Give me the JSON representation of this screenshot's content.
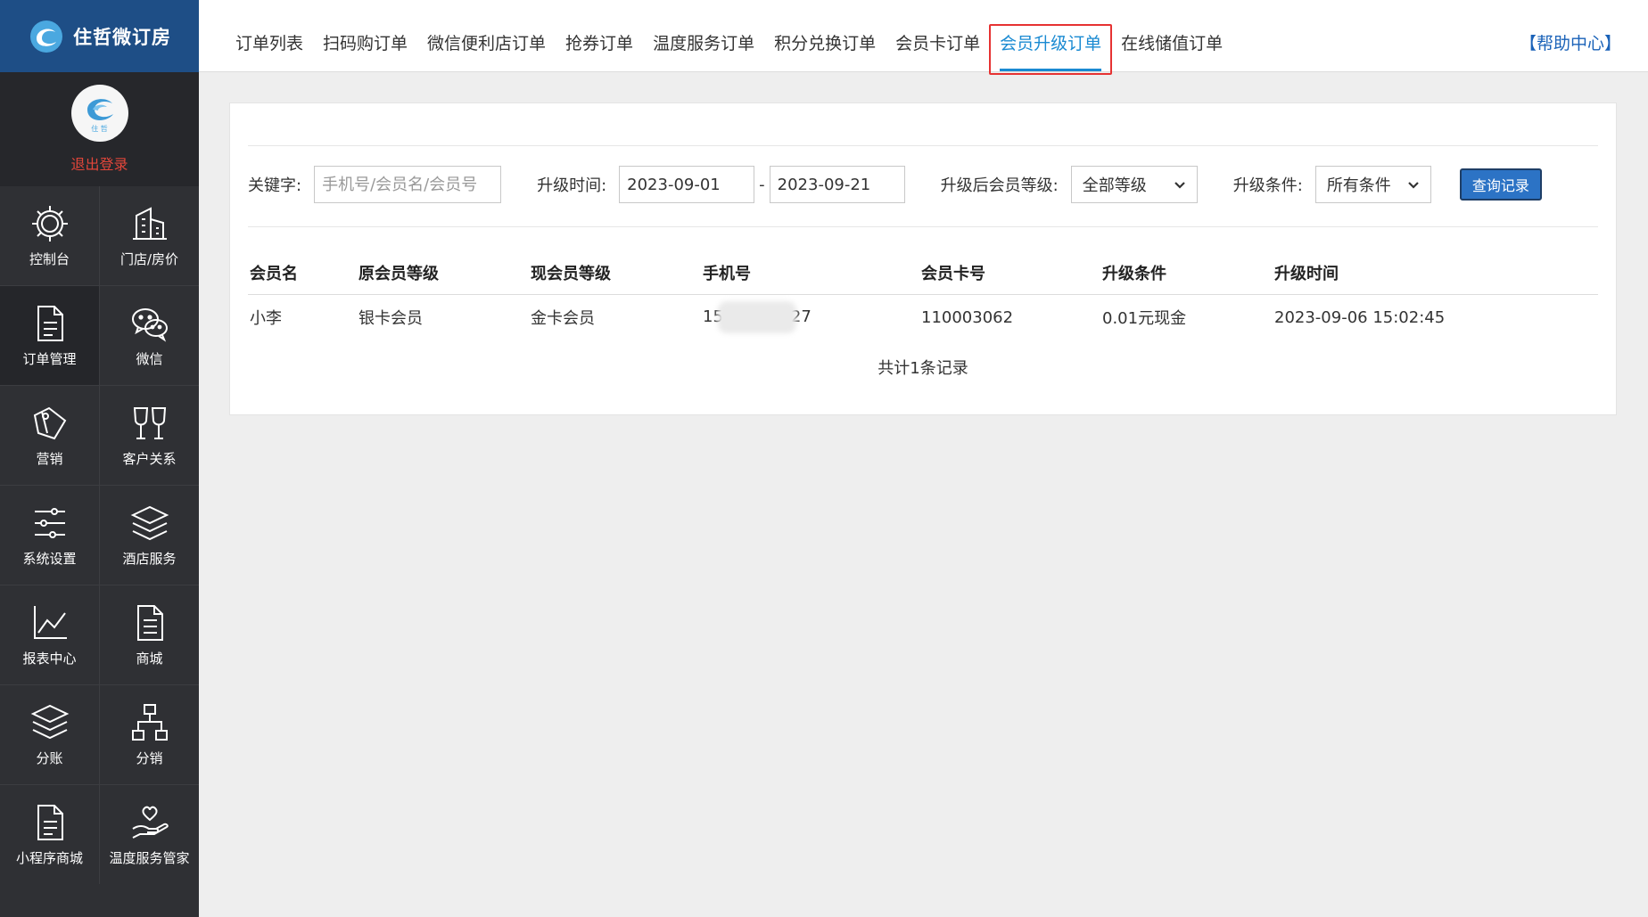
{
  "brand": {
    "name": "住哲微订房",
    "avatar_tag": "住 哲"
  },
  "user": {
    "logout_label": "退出登录"
  },
  "sidebar": {
    "items": [
      {
        "label": "控制台",
        "icon": "gear-icon"
      },
      {
        "label": "门店/房价",
        "icon": "building-icon"
      },
      {
        "label": "订单管理",
        "icon": "document-icon",
        "active": true
      },
      {
        "label": "微信",
        "icon": "wechat-icon"
      },
      {
        "label": "营销",
        "icon": "tag-icon"
      },
      {
        "label": "客户关系",
        "icon": "glasses-icon"
      },
      {
        "label": "系统设置",
        "icon": "sliders-icon"
      },
      {
        "label": "酒店服务",
        "icon": "layers-icon"
      },
      {
        "label": "报表中心",
        "icon": "chart-icon"
      },
      {
        "label": "商城",
        "icon": "document-lines-icon"
      },
      {
        "label": "分账",
        "icon": "stack-icon"
      },
      {
        "label": "分销",
        "icon": "org-tree-icon"
      },
      {
        "label": "小程序商城",
        "icon": "document-icon"
      },
      {
        "label": "温度服务管家",
        "icon": "heart-hand-icon"
      }
    ]
  },
  "tabs": [
    "订单列表",
    "扫码购订单",
    "微信便利店订单",
    "抢券订单",
    "温度服务订单",
    "积分兑换订单",
    "会员卡订单",
    "会员升级订单",
    "在线储值订单"
  ],
  "active_tab_index": 7,
  "help_label": "【帮助中心】",
  "filters": {
    "keyword_label": "关键字:",
    "keyword_placeholder": "手机号/会员名/会员号",
    "time_label": "升级时间:",
    "date_from": "2023-09-01",
    "date_sep": "-",
    "date_to": "2023-09-21",
    "level_label": "升级后会员等级:",
    "level_value": "全部等级",
    "condition_label": "升级条件:",
    "condition_value": "所有条件",
    "query_label": "查询记录"
  },
  "table": {
    "headers": [
      "会员名",
      "原会员等级",
      "现会员等级",
      "手机号",
      "会员卡号",
      "升级条件",
      "升级时间"
    ],
    "rows": [
      {
        "name": "小李",
        "old_level": "银卡会员",
        "new_level": "金卡会员",
        "phone_prefix": "15",
        "phone_suffix": "27",
        "card_no": "110003062",
        "condition": "0.01元现金",
        "time": "2023-09-06 15:02:45"
      }
    ],
    "summary": "共计1条记录"
  },
  "colors": {
    "brand_bar": "#1e4e86",
    "sidebar_bg": "#2f3034",
    "accent": "#1a8ad2",
    "highlight_outline": "#e63232",
    "logout": "#e2463a",
    "query_button": "#2c73c5"
  }
}
